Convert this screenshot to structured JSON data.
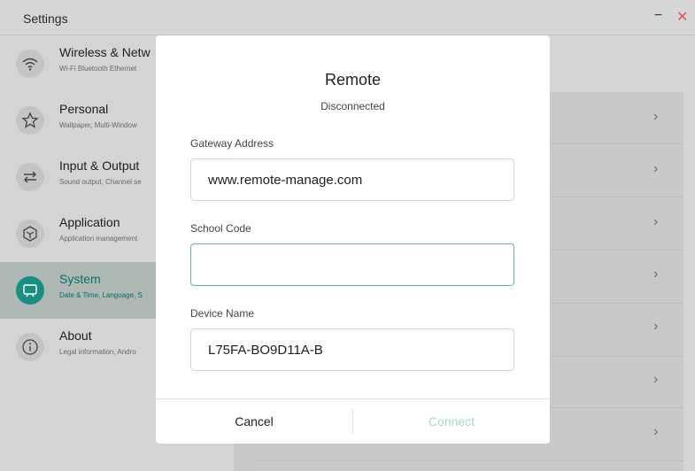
{
  "window": {
    "title": "Settings",
    "minimize": "−",
    "close": "✕"
  },
  "sidebar": {
    "items": [
      {
        "title": "Wireless & Netw",
        "subtitle": "Wi-Fi Bluetooth Ethernet",
        "icon": "wifi-icon",
        "active": false
      },
      {
        "title": "Personal",
        "subtitle": "Wallpaper, Multi-Window",
        "icon": "star-icon",
        "active": false
      },
      {
        "title": "Input & Output",
        "subtitle": "Sound output, Channel se",
        "icon": "swap-arrows-icon",
        "active": false
      },
      {
        "title": "Application",
        "subtitle": "Application management",
        "icon": "hexagon-cube-icon",
        "active": false
      },
      {
        "title": "System",
        "subtitle": "Date & Time, Language, S",
        "icon": "monitor-icon",
        "active": true
      },
      {
        "title": "About",
        "subtitle": "Legal information, Andro",
        "icon": "info-icon",
        "active": false
      }
    ]
  },
  "content": {
    "chevron": "›"
  },
  "dialog": {
    "title": "Remote",
    "status": "Disconnected",
    "gateway": {
      "label": "Gateway Address",
      "value": "www.remote-manage.com"
    },
    "school": {
      "label": "School Code",
      "value": ""
    },
    "device": {
      "label": "Device Name",
      "value": "L75FA-BO9D11A-B"
    },
    "cancel_label": "Cancel",
    "connect_label": "Connect"
  },
  "colors": {
    "accent": "#1a8e83",
    "focus_border": "#5eb7ad",
    "disabled_text": "#a7d6d0",
    "close": "#e05a4a"
  }
}
